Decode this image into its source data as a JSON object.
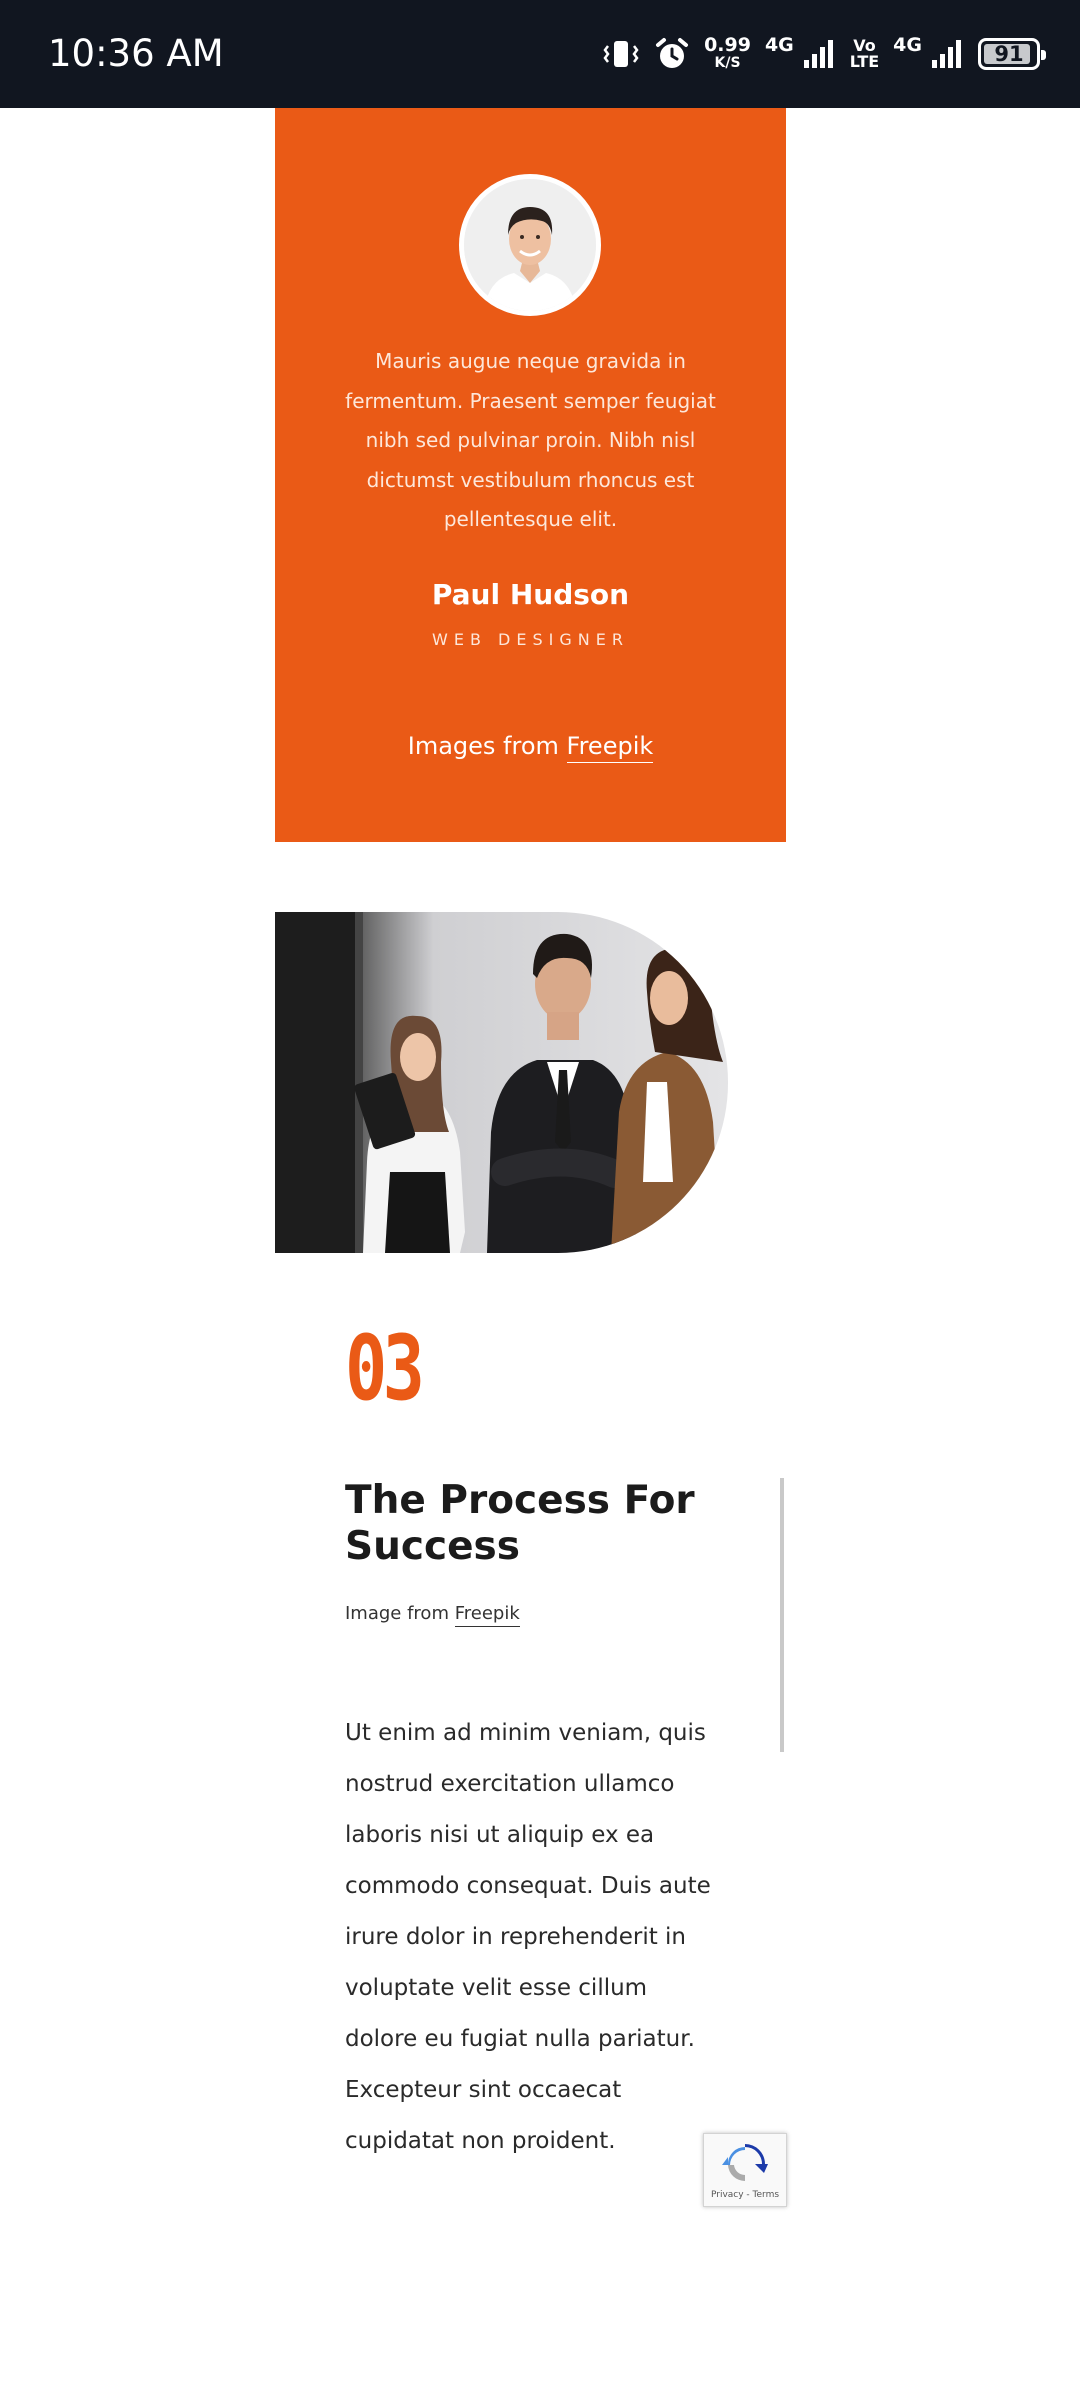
{
  "status_bar": {
    "time": "10:36 AM",
    "net_speed": "0.99",
    "net_unit": "K/S",
    "sim1_tech": "4G",
    "volte_top": "Vo",
    "volte_bottom": "LTE",
    "sim2_tech": "4G",
    "battery_level": "91",
    "icons": [
      "vibrate-icon",
      "alarm-icon",
      "signal-icon",
      "battery-icon"
    ]
  },
  "testimonial": {
    "background_color": "#ea5a16",
    "quote": "Mauris augue neque gravida in fermentum. Praesent semper feugiat nibh sed pulvinar proin. Nibh nisl dictumst vestibulum rhoncus est pellentesque elit.",
    "name": "Paul Hudson",
    "role": "WEB DESIGNER",
    "credit_prefix": "Images from",
    "credit_link": "Freepik"
  },
  "process": {
    "number": "03",
    "title": "The Process For Success",
    "image_credit_prefix": "Image from",
    "image_credit_link": "Freepik",
    "body": "Ut enim ad minim veniam, quis nostrud exercitation ullamco laboris nisi ut aliquip ex ea commodo consequat. Duis aute irure dolor in reprehenderit in voluptate velit esse cillum dolore eu fugiat nulla pariatur. Excepteur sint occaecat cupidatat non proident."
  },
  "recaptcha": {
    "label": "Privacy - Terms"
  }
}
